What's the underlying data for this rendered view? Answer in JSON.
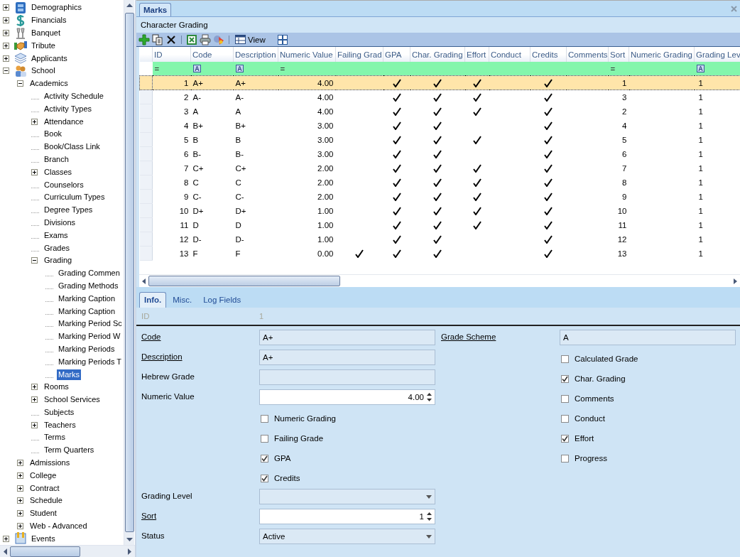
{
  "tree": [
    {
      "label": "Demographics",
      "expanded": false,
      "selected": false
    },
    {
      "label": "Financials",
      "expanded": false,
      "selected": false
    },
    {
      "label": "Banquet",
      "expanded": false,
      "selected": false
    },
    {
      "label": "Tribute",
      "expanded": false,
      "selected": false
    },
    {
      "label": "Applicants",
      "expanded": false,
      "selected": false
    },
    {
      "label": "School",
      "expanded": true,
      "selected": false,
      "children": [
        {
          "label": "Academics",
          "expanded": true,
          "selected": false,
          "children": [
            {
              "label": "Activity Schedule",
              "selected": false
            },
            {
              "label": "Activity Types",
              "selected": false
            },
            {
              "label": "Attendance",
              "expanded": false,
              "selected": false
            },
            {
              "label": "Book",
              "selected": false
            },
            {
              "label": "Book/Class Link",
              "selected": false
            },
            {
              "label": "Branch",
              "selected": false
            },
            {
              "label": "Classes",
              "expanded": false,
              "selected": false
            },
            {
              "label": "Counselors",
              "selected": false
            },
            {
              "label": "Curriculum Types",
              "selected": false
            },
            {
              "label": "Degree Types",
              "selected": false
            },
            {
              "label": "Divisions",
              "selected": false
            },
            {
              "label": "Exams",
              "selected": false
            },
            {
              "label": "Grades",
              "selected": false
            },
            {
              "label": "Grading",
              "expanded": true,
              "selected": false,
              "children": [
                {
                  "label": "Grading Commen",
                  "selected": false
                },
                {
                  "label": "Grading Methods",
                  "selected": false
                },
                {
                  "label": "Marking Caption",
                  "selected": false
                },
                {
                  "label": "Marking Caption",
                  "selected": false
                },
                {
                  "label": "Marking Period Sc",
                  "selected": false
                },
                {
                  "label": "Marking Period W",
                  "selected": false
                },
                {
                  "label": "Marking Periods",
                  "selected": false
                },
                {
                  "label": "Marking Periods T",
                  "selected": false
                },
                {
                  "label": "Marks",
                  "selected": true
                }
              ]
            },
            {
              "label": "Rooms",
              "expanded": false,
              "selected": false
            },
            {
              "label": "School Services",
              "expanded": false,
              "selected": false
            },
            {
              "label": "Subjects",
              "selected": false
            },
            {
              "label": "Teachers",
              "expanded": false,
              "selected": false
            },
            {
              "label": "Terms",
              "selected": false
            },
            {
              "label": "Term Quarters",
              "selected": false
            }
          ]
        },
        {
          "label": "Admissions",
          "expanded": false,
          "selected": false
        },
        {
          "label": "College",
          "expanded": false,
          "selected": false
        },
        {
          "label": "Contract",
          "expanded": false,
          "selected": false
        },
        {
          "label": "Schedule",
          "expanded": false,
          "selected": false
        },
        {
          "label": "Student",
          "expanded": false,
          "selected": false
        },
        {
          "label": "Web - Advanced",
          "expanded": false,
          "selected": false
        }
      ]
    },
    {
      "label": "Events",
      "expanded": false,
      "selected": false
    }
  ],
  "document_tab": {
    "label": "Marks",
    "selected": true
  },
  "caption": "Character Grading",
  "toolbar": {
    "view_label": "View"
  },
  "table": {
    "columns": [
      {
        "label": "ID",
        "kind": "number"
      },
      {
        "label": "Code",
        "kind": "text"
      },
      {
        "label": "Description",
        "kind": "text"
      },
      {
        "label": "Numeric Value",
        "kind": "number"
      },
      {
        "label": "Failing Grad",
        "kind": "check"
      },
      {
        "label": "GPA",
        "kind": "check"
      },
      {
        "label": "Char. Grading",
        "kind": "check"
      },
      {
        "label": "Effort",
        "kind": "check"
      },
      {
        "label": "Conduct",
        "kind": "check"
      },
      {
        "label": "Credits",
        "kind": "check"
      },
      {
        "label": "Comments",
        "kind": "check"
      },
      {
        "label": "Sort",
        "kind": "number"
      },
      {
        "label": "Numeric Grading",
        "kind": "check"
      },
      {
        "label": "Grading Lev",
        "kind": "text"
      }
    ],
    "filters": [
      {
        "kind": "equals",
        "text": "="
      },
      {
        "kind": "text"
      },
      {
        "kind": "text"
      },
      {
        "kind": "equals",
        "text": "="
      },
      {
        "kind": "none"
      },
      {
        "kind": "none"
      },
      {
        "kind": "none"
      },
      {
        "kind": "none"
      },
      {
        "kind": "none"
      },
      {
        "kind": "none"
      },
      {
        "kind": "none"
      },
      {
        "kind": "equals",
        "text": "="
      },
      {
        "kind": "none"
      },
      {
        "kind": "text"
      }
    ],
    "rows": [
      {
        "cells": [
          "1",
          "A+",
          "A+",
          "4.00",
          false,
          true,
          true,
          true,
          false,
          true,
          false,
          "1",
          false,
          "1"
        ],
        "selected": true
      },
      {
        "cells": [
          "2",
          "A-",
          "A-",
          "4.00",
          false,
          true,
          true,
          true,
          false,
          true,
          false,
          "3",
          false,
          "1"
        ],
        "selected": false
      },
      {
        "cells": [
          "3",
          "A",
          "A",
          "4.00",
          false,
          true,
          true,
          true,
          false,
          true,
          false,
          "2",
          false,
          "1"
        ],
        "selected": false
      },
      {
        "cells": [
          "4",
          "B+",
          "B+",
          "3.00",
          false,
          true,
          true,
          false,
          false,
          true,
          false,
          "4",
          false,
          "1"
        ],
        "selected": false
      },
      {
        "cells": [
          "5",
          "B",
          "B",
          "3.00",
          false,
          true,
          true,
          true,
          false,
          true,
          false,
          "5",
          false,
          "1"
        ],
        "selected": false
      },
      {
        "cells": [
          "6",
          "B-",
          "B-",
          "3.00",
          false,
          true,
          true,
          false,
          false,
          true,
          false,
          "6",
          false,
          "1"
        ],
        "selected": false
      },
      {
        "cells": [
          "7",
          "C+",
          "C+",
          "2.00",
          false,
          true,
          true,
          true,
          false,
          true,
          false,
          "7",
          false,
          "1"
        ],
        "selected": false
      },
      {
        "cells": [
          "8",
          "C",
          "C",
          "2.00",
          false,
          true,
          true,
          true,
          false,
          true,
          false,
          "8",
          false,
          "1"
        ],
        "selected": false
      },
      {
        "cells": [
          "9",
          "C-",
          "C-",
          "2.00",
          false,
          true,
          true,
          true,
          false,
          true,
          false,
          "9",
          false,
          "1"
        ],
        "selected": false
      },
      {
        "cells": [
          "10",
          "D+",
          "D+",
          "1.00",
          false,
          true,
          true,
          true,
          false,
          true,
          false,
          "10",
          false,
          "1"
        ],
        "selected": false
      },
      {
        "cells": [
          "11",
          "D",
          "D",
          "1.00",
          false,
          true,
          true,
          true,
          false,
          true,
          false,
          "11",
          false,
          "1"
        ],
        "selected": false
      },
      {
        "cells": [
          "12",
          "D-",
          "D-",
          "1.00",
          false,
          true,
          true,
          false,
          false,
          true,
          false,
          "12",
          false,
          "1"
        ],
        "selected": false
      },
      {
        "cells": [
          "13",
          "F",
          "F",
          "0.00",
          true,
          true,
          true,
          false,
          false,
          true,
          false,
          "13",
          false,
          "1"
        ],
        "selected": false
      }
    ]
  },
  "detail_tabs": [
    {
      "label": "Info.",
      "selected": true
    },
    {
      "label": "Misc.",
      "selected": false
    },
    {
      "label": "Log Fields",
      "selected": false
    }
  ],
  "id_field": {
    "label": "ID",
    "value": "1",
    "disabled": true
  },
  "form": {
    "left": [
      {
        "kind": "text",
        "label": "Code",
        "required": true,
        "value": "A+"
      },
      {
        "kind": "text",
        "label": "Description",
        "required": true,
        "value": "A+"
      },
      {
        "kind": "text",
        "label": "Hebrew Grade",
        "required": false
      },
      {
        "kind": "spin",
        "label": "Numeric Value",
        "required": false,
        "value": "4.00"
      },
      {
        "kind": "check",
        "label": "Numeric Grading",
        "checked": false
      },
      {
        "kind": "check",
        "label": "Failing Grade",
        "checked": false
      },
      {
        "kind": "check",
        "label": "GPA",
        "checked": true
      },
      {
        "kind": "check",
        "label": "Credits",
        "checked": true
      },
      {
        "kind": "dropdown",
        "label": "Grading Level",
        "required": false
      },
      {
        "kind": "spin",
        "label": "Sort",
        "required": true,
        "value": "1"
      },
      {
        "kind": "dropdown",
        "label": "Status",
        "required": false,
        "value": "Active"
      }
    ],
    "right": [
      {
        "kind": "text",
        "label": "Grade Scheme",
        "required": true,
        "value": "A"
      },
      {
        "kind": "check",
        "label": "Calculated Grade",
        "checked": false
      },
      {
        "kind": "check",
        "label": "Char. Grading",
        "checked": true
      },
      {
        "kind": "check",
        "label": "Comments",
        "checked": false
      },
      {
        "kind": "check",
        "label": "Conduct",
        "checked": false
      },
      {
        "kind": "check",
        "label": "Effort",
        "checked": true
      },
      {
        "kind": "check",
        "label": "Progress",
        "checked": false
      }
    ]
  }
}
